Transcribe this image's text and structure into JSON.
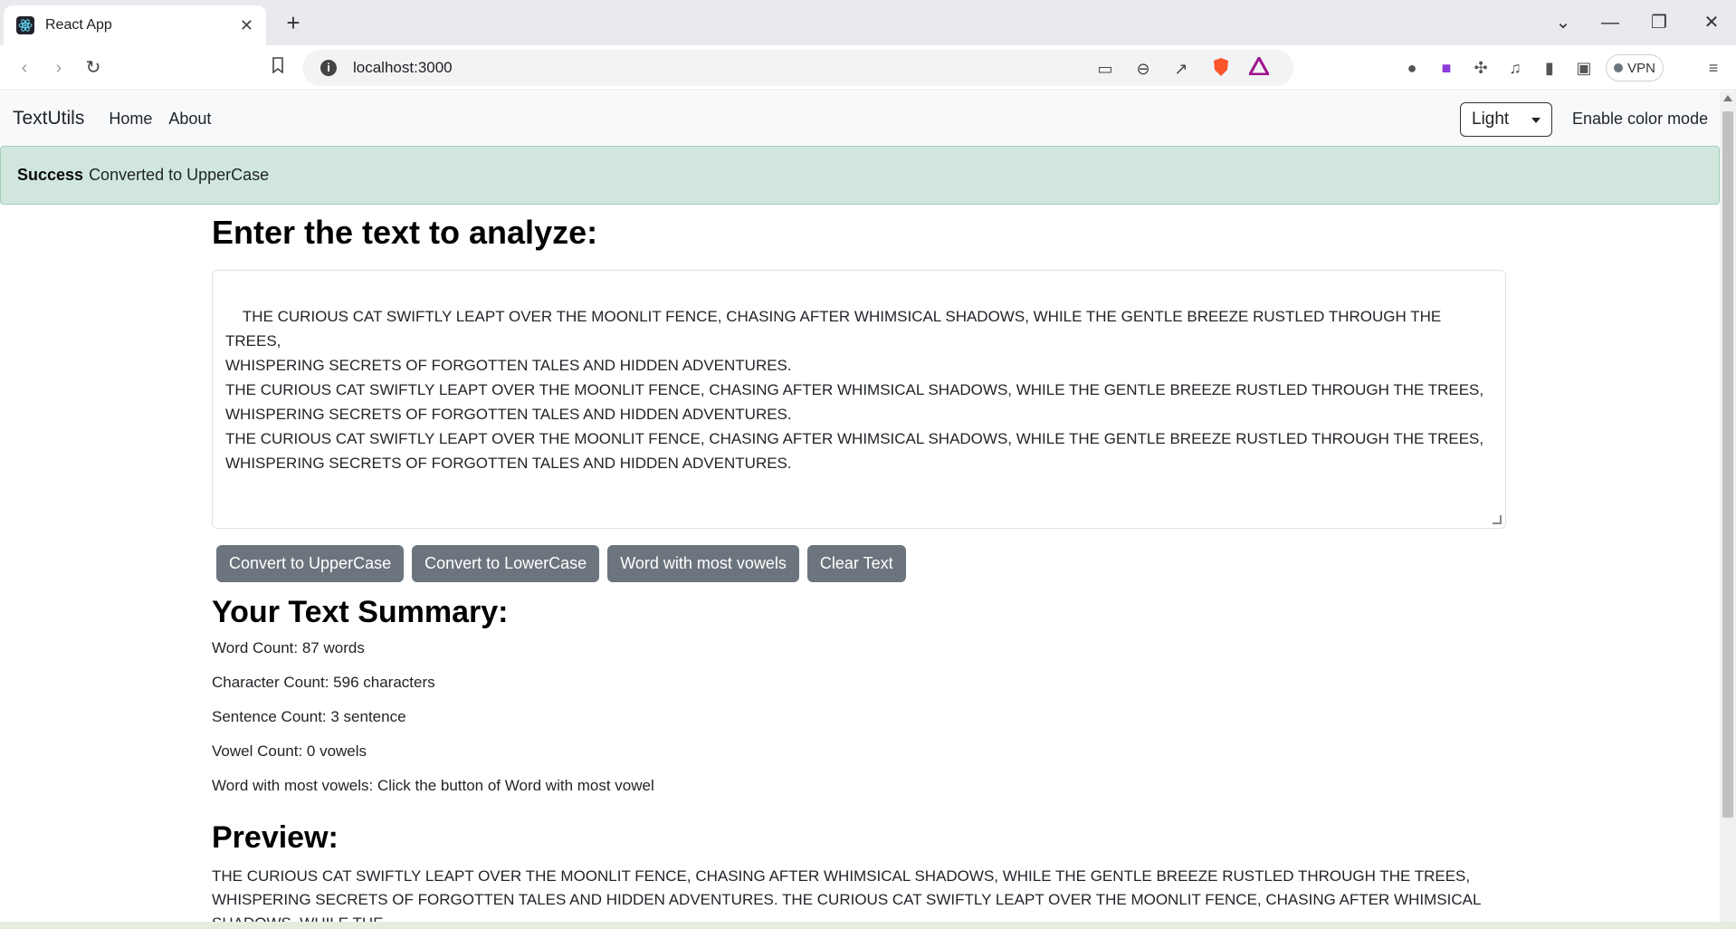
{
  "browser": {
    "tab_title": "React App",
    "url": "localhost:3000",
    "vpn_label": "VPN"
  },
  "navbar": {
    "brand": "TextUtils",
    "links": [
      "Home",
      "About"
    ],
    "mode_value": "Light",
    "mode_label": "Enable color mode"
  },
  "alert": {
    "type": "Success",
    "message": "Converted to UpperCase"
  },
  "main": {
    "heading": "Enter the text to analyze:",
    "text": "THE CURIOUS CAT SWIFTLY LEAPT OVER THE MOONLIT FENCE, CHASING AFTER WHIMSICAL SHADOWS, WHILE THE GENTLE BREEZE RUSTLED THROUGH THE TREES,\nWHISPERING SECRETS OF FORGOTTEN TALES AND HIDDEN ADVENTURES.\nTHE CURIOUS CAT SWIFTLY LEAPT OVER THE MOONLIT FENCE, CHASING AFTER WHIMSICAL SHADOWS, WHILE THE GENTLE BREEZE RUSTLED THROUGH THE TREES,\nWHISPERING SECRETS OF FORGOTTEN TALES AND HIDDEN ADVENTURES.\nTHE CURIOUS CAT SWIFTLY LEAPT OVER THE MOONLIT FENCE, CHASING AFTER WHIMSICAL SHADOWS, WHILE THE GENTLE BREEZE RUSTLED THROUGH THE TREES,\nWHISPERING SECRETS OF FORGOTTEN TALES AND HIDDEN ADVENTURES.",
    "buttons": {
      "upper": "Convert to UpperCase",
      "lower": "Convert to LowerCase",
      "vowels": "Word with most vowels",
      "clear": "Clear Text"
    }
  },
  "summary": {
    "title": "Your Text Summary:",
    "word_count": "Word Count: 87 words",
    "char_count": "Character Count: 596 characters",
    "sentence_count": "Sentence Count: 3 sentence",
    "vowel_count": "Vowel Count: 0 vowels",
    "most_vowels": "Word with most vowels: Click the button of Word with most vowel"
  },
  "preview": {
    "title": "Preview:",
    "text": "THE CURIOUS CAT SWIFTLY LEAPT OVER THE MOONLIT FENCE, CHASING AFTER WHIMSICAL SHADOWS, WHILE THE GENTLE BREEZE RUSTLED THROUGH THE TREES, WHISPERING SECRETS OF FORGOTTEN TALES AND HIDDEN ADVENTURES. THE CURIOUS CAT SWIFTLY LEAPT OVER THE MOONLIT FENCE, CHASING AFTER WHIMSICAL SHADOWS, WHILE THE"
  },
  "colors": {
    "alert_bg": "#d1e7dd",
    "button_bg": "#6c757d",
    "navbar_bg": "#f8f9fa"
  }
}
